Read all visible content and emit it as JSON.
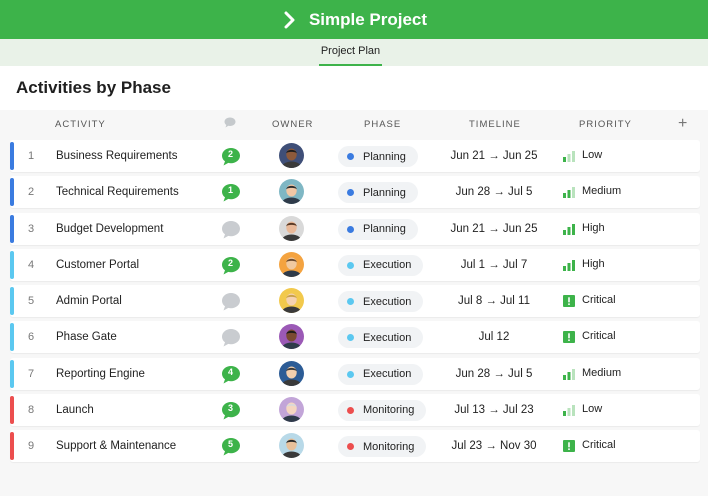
{
  "app": {
    "title": "Simple Project",
    "tab": "Project Plan"
  },
  "page_title": "Activities by Phase",
  "columns": {
    "activity": "ACTIVITY",
    "owner": "OWNER",
    "phase": "PHASE",
    "timeline": "TIMELINE",
    "priority": "PRIORITY",
    "add": "+"
  },
  "colors": {
    "brand": "#3db34a",
    "planning": "#3a7be0",
    "execution": "#5bc8f0",
    "monitoring": "#ec4e4e"
  },
  "rows": [
    {
      "num": "1",
      "name": "Business Requirements",
      "comments": "2",
      "phase": "Planning",
      "timeline": "Jun 21 → Jun 25",
      "priority": "Low",
      "prio_level": 1
    },
    {
      "num": "2",
      "name": "Technical Requirements",
      "comments": "1",
      "phase": "Planning",
      "timeline": "Jun 28 → Jul 5",
      "priority": "Medium",
      "prio_level": 2
    },
    {
      "num": "3",
      "name": "Budget Development",
      "comments": "",
      "phase": "Planning",
      "timeline": "Jun 21 → Jun 25",
      "priority": "High",
      "prio_level": 3
    },
    {
      "num": "4",
      "name": "Customer Portal",
      "comments": "2",
      "phase": "Execution",
      "timeline": "Jul 1 → Jul 7",
      "priority": "High",
      "prio_level": 3
    },
    {
      "num": "5",
      "name": "Admin Portal",
      "comments": "",
      "phase": "Execution",
      "timeline": "Jul 8 → Jul 11",
      "priority": "Critical",
      "prio_level": 4
    },
    {
      "num": "6",
      "name": "Phase Gate",
      "comments": "",
      "phase": "Execution",
      "timeline": "Jul 12",
      "priority": "Critical",
      "prio_level": 4
    },
    {
      "num": "7",
      "name": "Reporting Engine",
      "comments": "4",
      "phase": "Execution",
      "timeline": "Jun 28 → Jul 5",
      "priority": "Medium",
      "prio_level": 2
    },
    {
      "num": "8",
      "name": "Launch",
      "comments": "3",
      "phase": "Monitoring",
      "timeline": "Jul 13 → Jul 23",
      "priority": "Low",
      "prio_level": 1
    },
    {
      "num": "9",
      "name": "Support & Maintenance",
      "comments": "5",
      "phase": "Monitoring",
      "timeline": "Jul 23 → Nov 30",
      "priority": "Critical",
      "prio_level": 4
    }
  ]
}
